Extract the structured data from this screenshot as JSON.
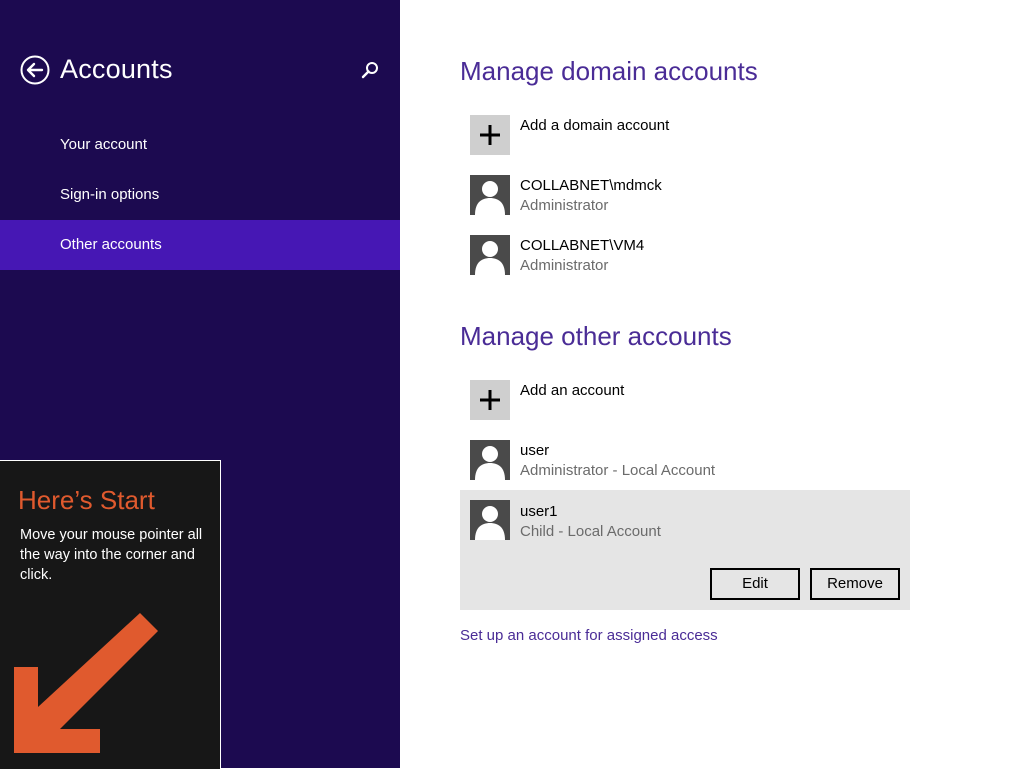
{
  "sidebar": {
    "title": "Accounts",
    "items": [
      {
        "label": "Your account",
        "selected": false
      },
      {
        "label": "Sign-in options",
        "selected": false
      },
      {
        "label": "Other accounts",
        "selected": true
      }
    ]
  },
  "start_tip": {
    "title": "Here’s Start",
    "body": "Move your mouse pointer all the way into the corner and click."
  },
  "domain_section": {
    "heading": "Manage domain accounts",
    "add_label": "Add a domain account",
    "accounts": [
      {
        "name": "COLLABNET\\mdmck",
        "role": "Administrator"
      },
      {
        "name": "COLLABNET\\VM4",
        "role": "Administrator"
      }
    ]
  },
  "other_section": {
    "heading": "Manage other accounts",
    "add_label": "Add an account",
    "accounts": [
      {
        "name": "user",
        "role": "Administrator - Local Account"
      },
      {
        "name": "user1",
        "role": "Child - Local Account",
        "expanded": true
      }
    ],
    "edit_label": "Edit",
    "remove_label": "Remove"
  },
  "assigned_access_link": "Set up an account for assigned access",
  "colors": {
    "sidebar_bg": "#1c0a50",
    "selected_bg": "#4617b4",
    "accent_text": "#4a2c96",
    "tip_title": "#e05a2e"
  },
  "icons": [
    "back-arrow-icon",
    "search-icon",
    "plus-icon",
    "user-icon"
  ]
}
